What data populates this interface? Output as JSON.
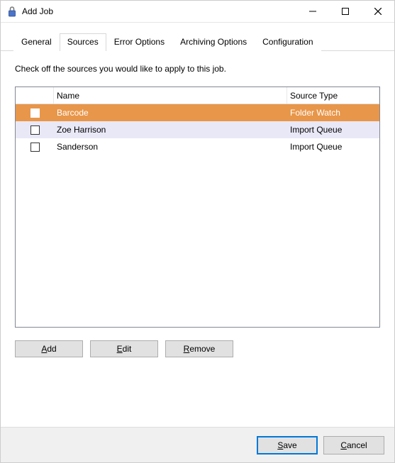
{
  "window": {
    "title": "Add Job"
  },
  "tabs": {
    "general": "General",
    "sources": "Sources",
    "error_options": "Error Options",
    "archiving_options": "Archiving Options",
    "configuration": "Configuration",
    "active": "sources"
  },
  "panel": {
    "instruction": "Check off the sources you would like to apply to this job."
  },
  "grid": {
    "headers": {
      "name": "Name",
      "source_type": "Source Type"
    },
    "rows": [
      {
        "checked": false,
        "name": "Barcode",
        "source_type": "Folder Watch",
        "state": "selected"
      },
      {
        "checked": false,
        "name": "Zoe Harrison",
        "source_type": "Import Queue",
        "state": "hover"
      },
      {
        "checked": false,
        "name": "Sanderson",
        "source_type": "Import Queue",
        "state": ""
      }
    ]
  },
  "buttons": {
    "add": "Add",
    "edit": "Edit",
    "remove": "Remove"
  },
  "footer": {
    "save": "Save",
    "cancel": "Cancel"
  }
}
